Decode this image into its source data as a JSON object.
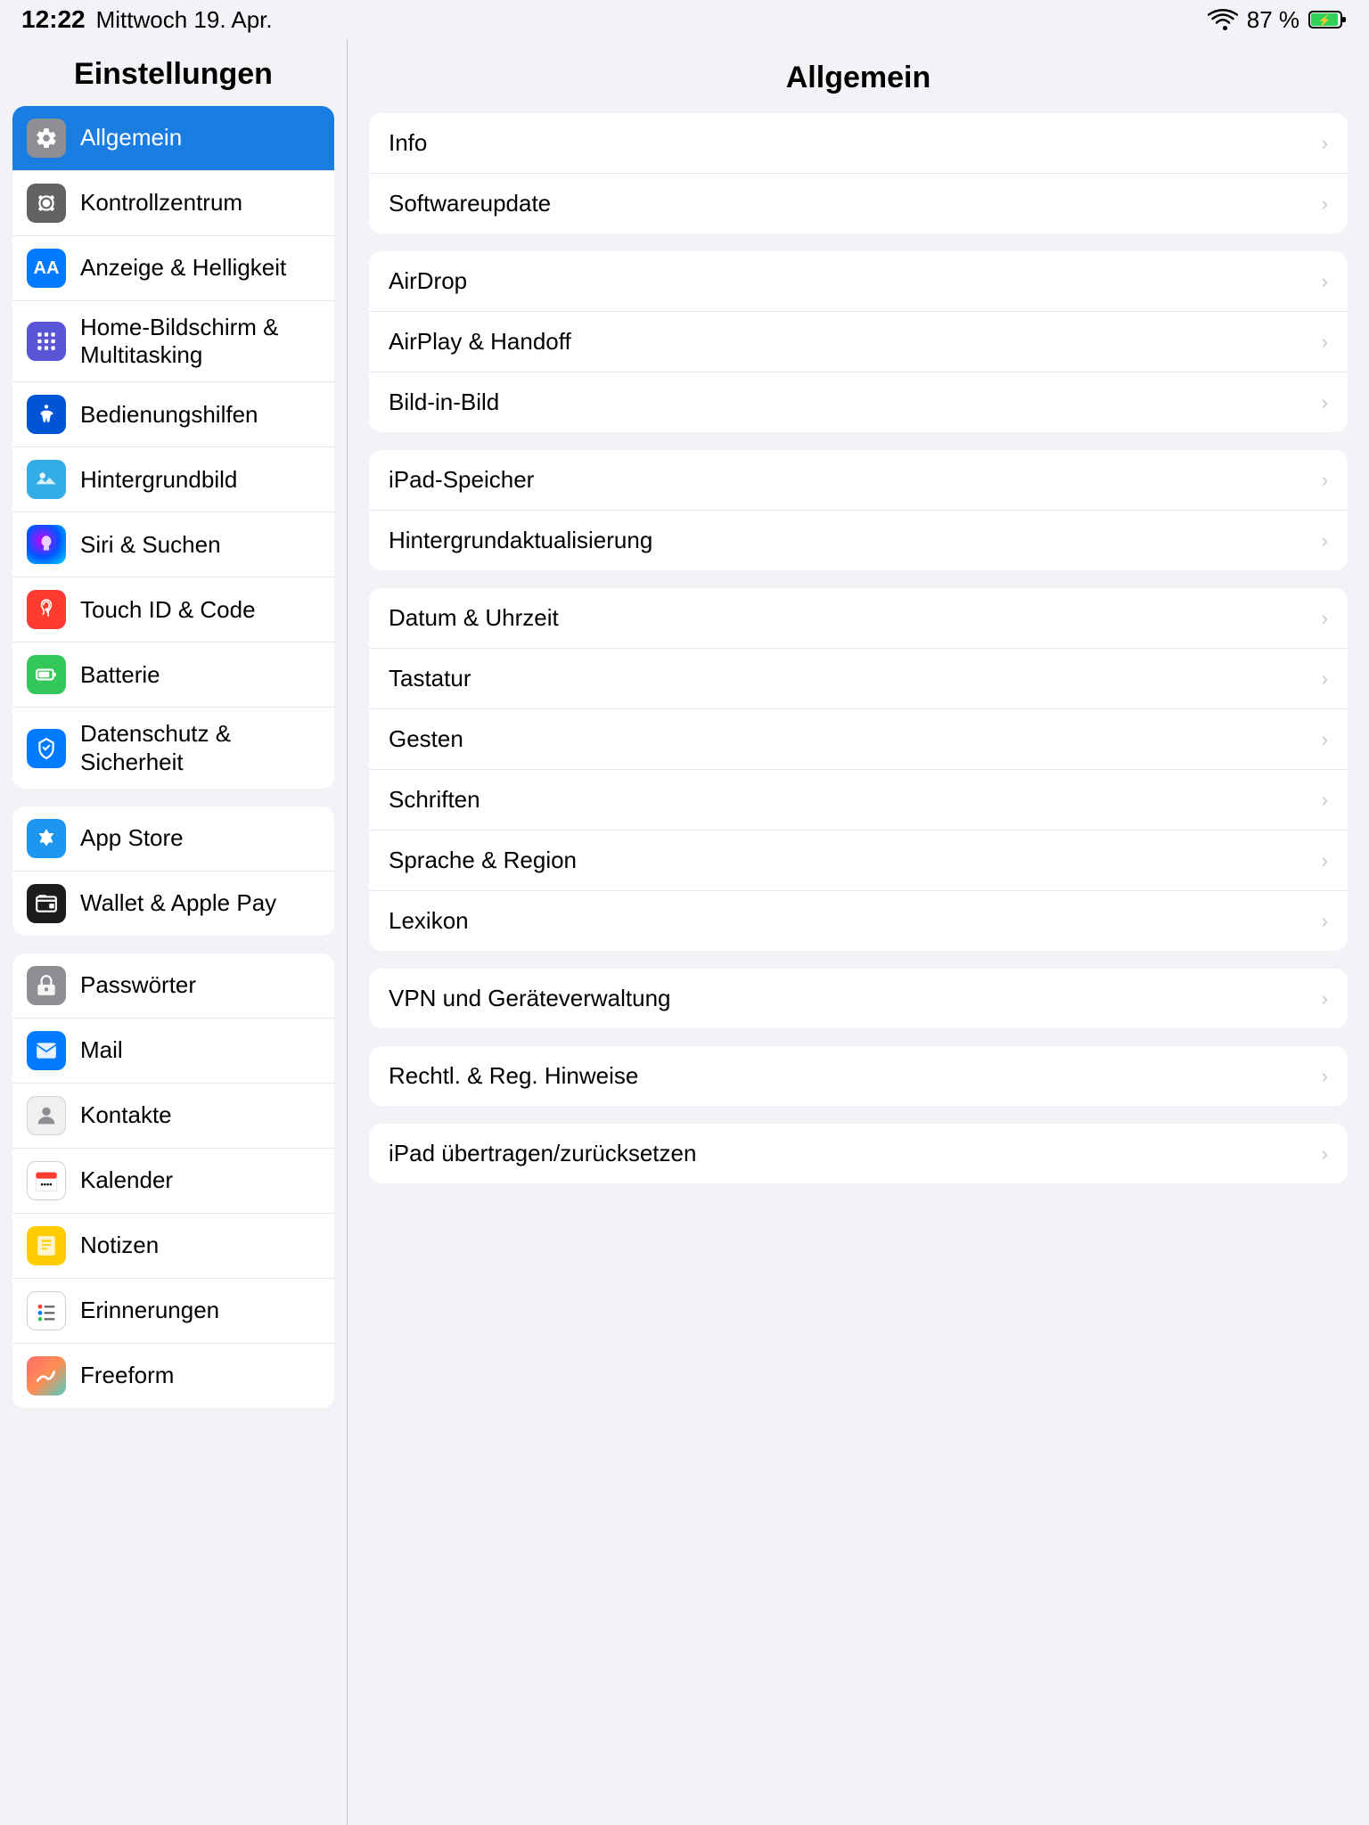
{
  "status": {
    "time": "12:22",
    "day": "Mittwoch 19. Apr.",
    "battery": "87 %",
    "wifi": true
  },
  "sidebar": {
    "title": "Einstellungen",
    "groups": [
      {
        "id": "system",
        "items": [
          {
            "id": "allgemein",
            "label": "Allgemein",
            "icon": "gear",
            "iconColor": "icon-gray",
            "active": true
          },
          {
            "id": "kontrollzentrum",
            "label": "Kontrollzentrum",
            "icon": "kontroll",
            "iconColor": "icon-gray2",
            "active": false
          },
          {
            "id": "anzeige",
            "label": "Anzeige & Helligkeit",
            "icon": "aa",
            "iconColor": "icon-blue",
            "active": false
          },
          {
            "id": "home",
            "label": "Home-Bildschirm & Multitasking",
            "icon": "home",
            "iconColor": "icon-purple",
            "active": false
          },
          {
            "id": "bedienungshilfen",
            "label": "Bedienungshilfen",
            "icon": "accessibility",
            "iconColor": "icon-blue2",
            "active": false
          },
          {
            "id": "hintergrund",
            "label": "Hintergrundbild",
            "icon": "wallpaper",
            "iconColor": "icon-teal",
            "active": false
          },
          {
            "id": "siri",
            "label": "Siri & Suchen",
            "icon": "siri",
            "iconColor": "icon-dark-blue",
            "active": false
          },
          {
            "id": "touchid",
            "label": "Touch ID & Code",
            "icon": "touchid",
            "iconColor": "icon-red",
            "active": false
          },
          {
            "id": "batterie",
            "label": "Batterie",
            "icon": "battery",
            "iconColor": "icon-green",
            "active": false
          },
          {
            "id": "datenschutz",
            "label": "Datenschutz & Sicherheit",
            "icon": "hand",
            "iconColor": "icon-blue",
            "active": false
          }
        ]
      },
      {
        "id": "store",
        "items": [
          {
            "id": "appstore",
            "label": "App Store",
            "icon": "appstore",
            "iconColor": "icon-app-store",
            "active": false
          },
          {
            "id": "wallet",
            "label": "Wallet & Apple Pay",
            "icon": "wallet",
            "iconColor": "icon-wallet",
            "active": false
          }
        ]
      },
      {
        "id": "apps",
        "items": [
          {
            "id": "passwoerter",
            "label": "Passwörter",
            "icon": "key",
            "iconColor": "icon-gray",
            "active": false
          },
          {
            "id": "mail",
            "label": "Mail",
            "icon": "mail",
            "iconColor": "icon-blue",
            "active": false
          },
          {
            "id": "kontakte",
            "label": "Kontakte",
            "icon": "contacts",
            "iconColor": "icon-white-gray",
            "active": false
          },
          {
            "id": "kalender",
            "label": "Kalender",
            "icon": "calendar",
            "iconColor": "icon-white-gray",
            "active": false
          },
          {
            "id": "notizen",
            "label": "Notizen",
            "icon": "notes",
            "iconColor": "icon-yellow",
            "active": false
          },
          {
            "id": "erinnerungen",
            "label": "Erinnerungen",
            "icon": "reminders",
            "iconColor": "icon-white-gray",
            "active": false
          },
          {
            "id": "freeform",
            "label": "Freeform",
            "icon": "freeform",
            "iconColor": "icon-freeform",
            "active": false
          }
        ]
      }
    ]
  },
  "detail": {
    "title": "Allgemein",
    "groups": [
      {
        "id": "info-group",
        "items": [
          {
            "id": "info",
            "label": "Info"
          },
          {
            "id": "softwareupdate",
            "label": "Softwareupdate"
          }
        ]
      },
      {
        "id": "connectivity-group",
        "items": [
          {
            "id": "airdrop",
            "label": "AirDrop"
          },
          {
            "id": "airplay",
            "label": "AirPlay & Handoff"
          },
          {
            "id": "bildinbild",
            "label": "Bild-in-Bild"
          }
        ]
      },
      {
        "id": "storage-group",
        "items": [
          {
            "id": "ipad-speicher",
            "label": "iPad-Speicher"
          },
          {
            "id": "hintergrundaktualisierung",
            "label": "Hintergrundaktualisierung"
          }
        ]
      },
      {
        "id": "locale-group",
        "items": [
          {
            "id": "datum-uhrzeit",
            "label": "Datum & Uhrzeit"
          },
          {
            "id": "tastatur",
            "label": "Tastatur"
          },
          {
            "id": "gesten",
            "label": "Gesten"
          },
          {
            "id": "schriften",
            "label": "Schriften"
          },
          {
            "id": "sprache-region",
            "label": "Sprache & Region"
          },
          {
            "id": "lexikon",
            "label": "Lexikon"
          }
        ]
      },
      {
        "id": "vpn-group",
        "items": [
          {
            "id": "vpn",
            "label": "VPN und Geräteverwaltung"
          }
        ]
      },
      {
        "id": "legal-group",
        "items": [
          {
            "id": "rechtliches",
            "label": "Rechtl. & Reg. Hinweise"
          }
        ]
      },
      {
        "id": "reset-group",
        "items": [
          {
            "id": "ipad-reset",
            "label": "iPad übertragen/zurücksetzen"
          }
        ]
      }
    ]
  }
}
